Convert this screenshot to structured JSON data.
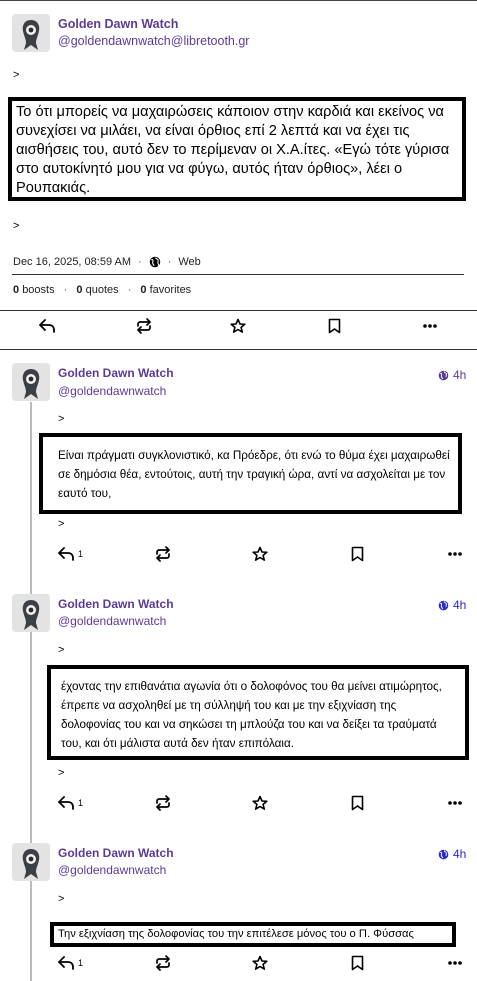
{
  "main_post": {
    "author_name": "Golden Dawn Watch",
    "author_handle": "@goldendawnwatch@libretooth.gr",
    "quote_marker_top": ">",
    "quote_text": "Το ότι μπορείς να μαχαιρώσεις κάποιον στην καρδιά και εκείνος να συνεχίσει να μιλάει, να είναι όρθιος επί 2 λεπτά και να έχει τις αισθήσεις του, αυτό δεν το περίμεναν οι Χ.Α.ίτες. «Εγώ τότε γύρισα στο αυτοκίνητό μου για να φύγω, αυτός ήταν όρθιος», λέει ο Ρουπακιάς.",
    "quote_marker_bottom": ">",
    "date": "Dec 16, 2025, 08:59 AM",
    "visibility_icon": "globe-icon",
    "client": "Web",
    "boosts_count": "0",
    "boosts_label": "boosts",
    "quotes_count": "0",
    "quotes_label": "quotes",
    "favorites_count": "0",
    "favorites_label": "favorites"
  },
  "replies": [
    {
      "author_name": "Golden Dawn Watch",
      "author_handle": "@goldendawnwatch",
      "time": "4h",
      "marker_top": ">",
      "text": "Είναι πράγματι συγκλονιστικό, κα Πρόεδρε, ότι ενώ το θύμα έχει μαχαιρωθεί σε δημόσια θέα, εντούτοις, αυτή την τραγική ώρα, αντί να ασχολείται με τον εαυτό του,",
      "marker_bottom": ">",
      "reply_count": "1"
    },
    {
      "author_name": "Golden Dawn Watch",
      "author_handle": "@goldendawnwatch",
      "time": "4h",
      "marker_top": ">",
      "text": "έχοντας την επιθανάτια αγωνία ότι ο δολοφόνος του θα μείνει ατιμώρητος, έπρεπε να ασχοληθεί με τη σύλληψή του και με την εξιχνίαση της δολοφονίας του και να σηκώσει τη μπλούζα του και να δείξει τα τραύματά του, και ότι μάλιστα αυτά δεν ήταν επιπόλαια.",
      "marker_bottom": ">",
      "reply_count": "1"
    },
    {
      "author_name": "Golden Dawn Watch",
      "author_handle": "@goldendawnwatch",
      "time": "4h",
      "marker_top": ">",
      "text": "Την εξιχνίαση της δολοφονίας του την επιτέλεσε μόνος του ο Π. Φύσσας",
      "reply_count": "1"
    }
  ],
  "icons": {
    "reply": "reply-icon",
    "boost": "boost-icon",
    "favorite": "star-icon",
    "bookmark": "bookmark-icon",
    "more": "more-icon"
  },
  "colors": {
    "author": "#5c3b96",
    "time_blue": "#2a2ad0",
    "box_border": "#000000"
  }
}
